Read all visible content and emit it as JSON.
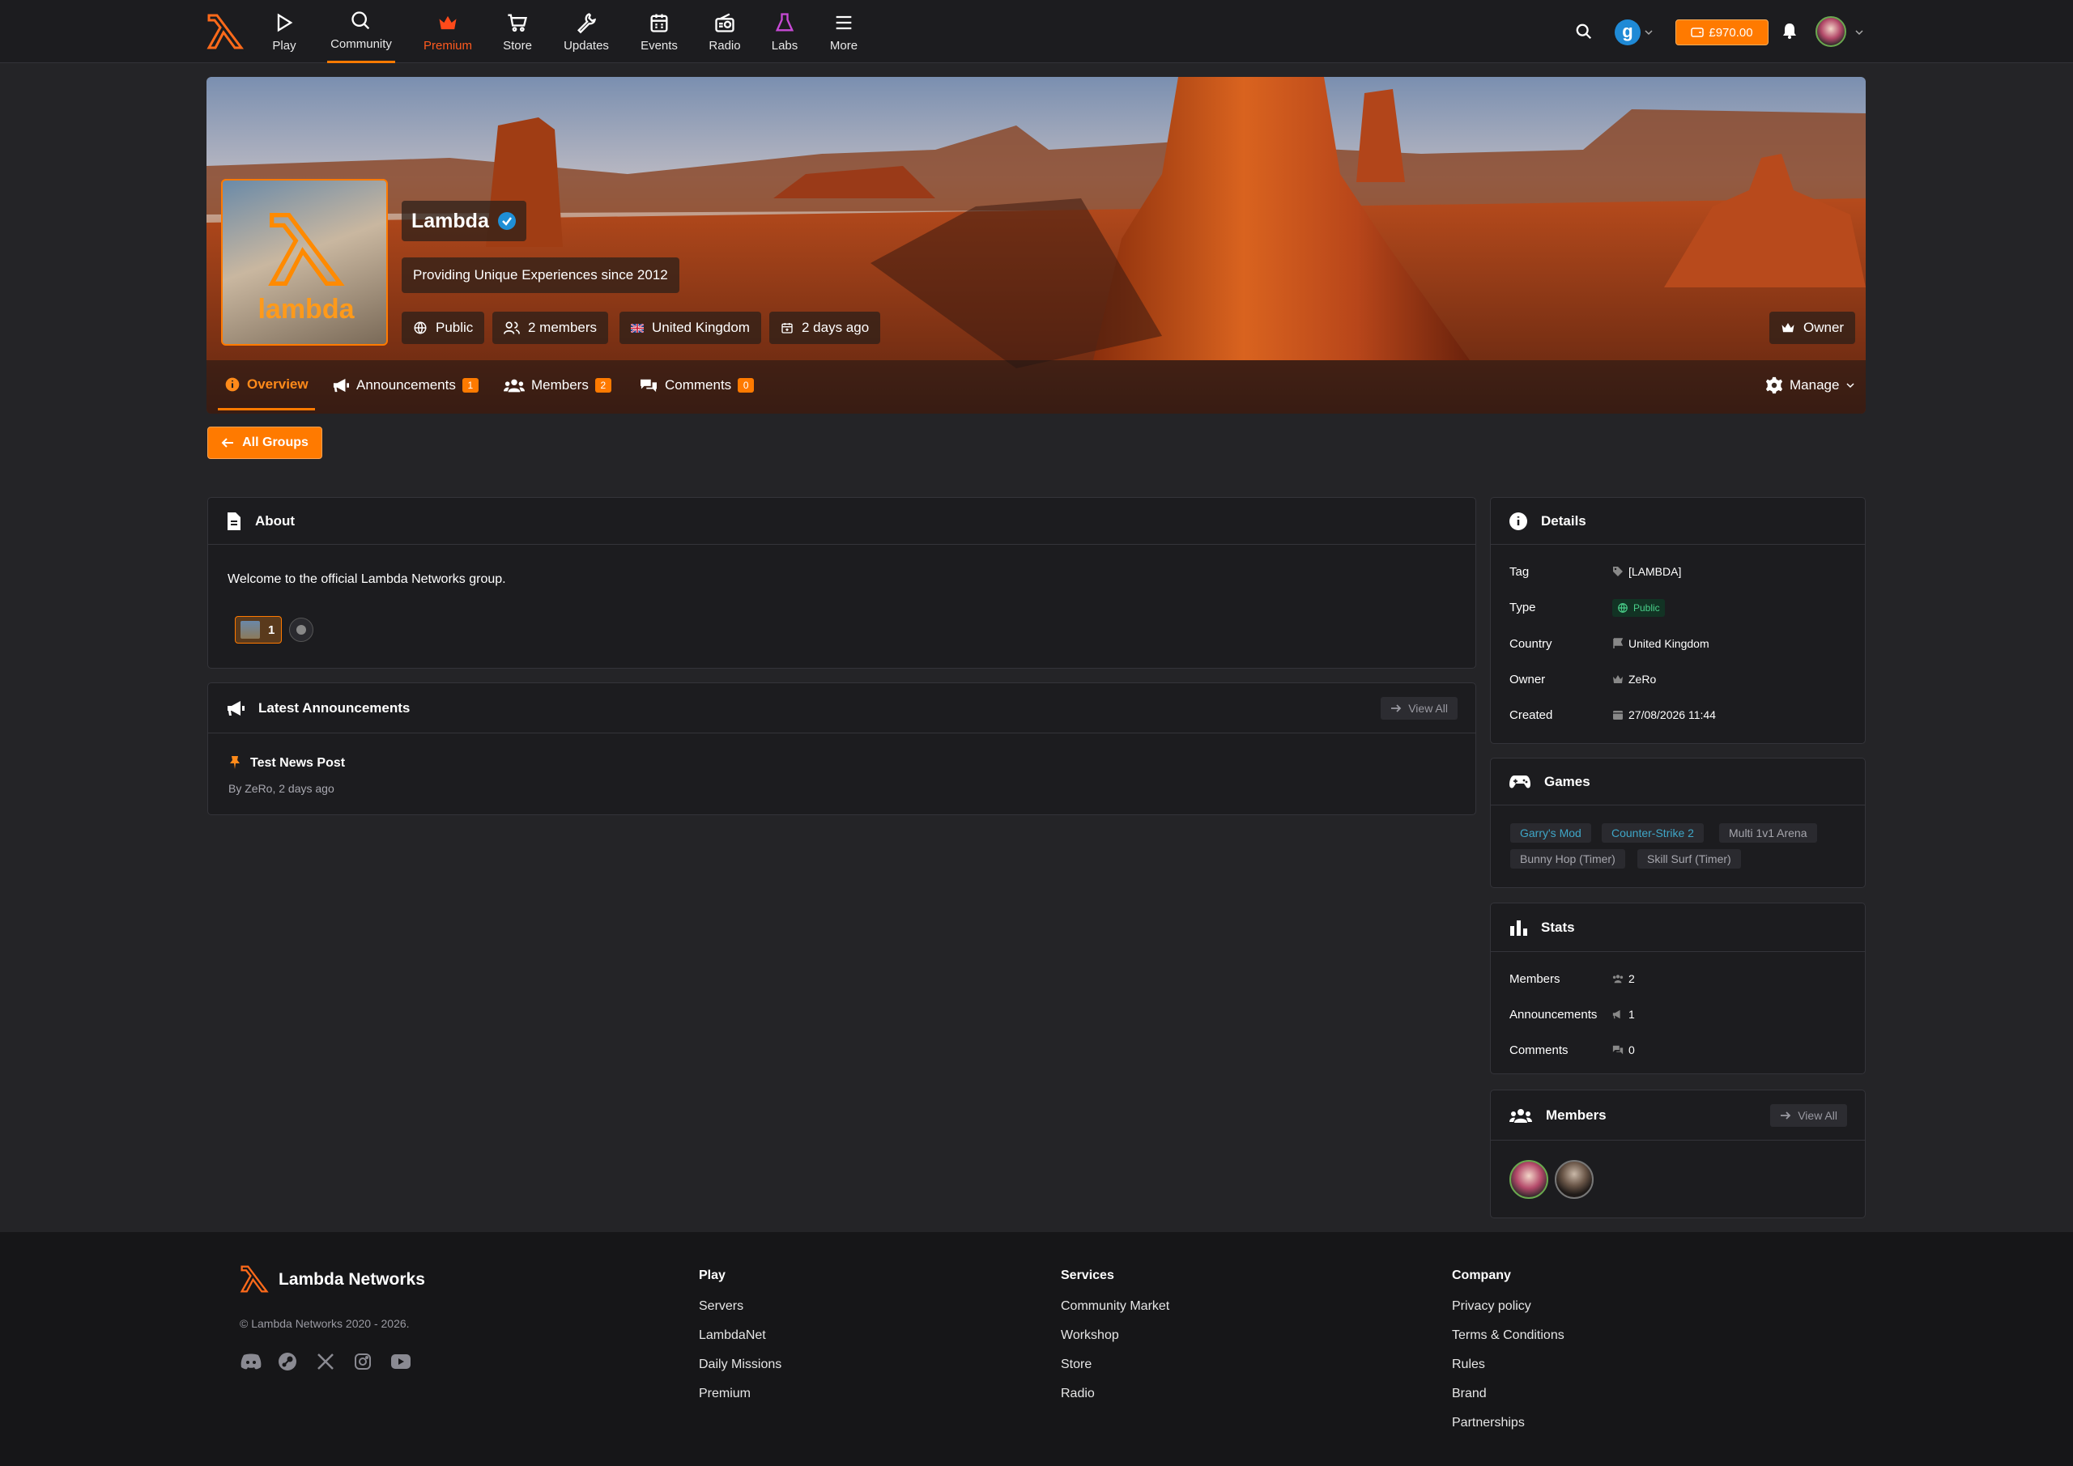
{
  "nav": {
    "items": [
      {
        "label": "Play",
        "icon": "play-icon"
      },
      {
        "label": "Community",
        "icon": "chat-icon"
      },
      {
        "label": "Premium",
        "icon": "crown-icon"
      },
      {
        "label": "Store",
        "icon": "cart-icon"
      },
      {
        "label": "Updates",
        "icon": "wrench-icon"
      },
      {
        "label": "Events",
        "icon": "calendar-icon"
      },
      {
        "label": "Radio",
        "icon": "radio-icon"
      },
      {
        "label": "Labs",
        "icon": "flask-icon"
      },
      {
        "label": "More",
        "icon": "menu-icon"
      }
    ],
    "active": "Community",
    "balance": "£970.00",
    "accent": "#ff7a00"
  },
  "group": {
    "name": "Lambda",
    "tagline": "Providing Unique Experiences since 2012",
    "avatar_text": "lambda",
    "visibility": "Public",
    "members": "2 members",
    "country": "United Kingdom",
    "created_ago": "2 days ago",
    "role": "Owner"
  },
  "tabs": [
    {
      "label": "Overview",
      "count": null
    },
    {
      "label": "Announcements",
      "count": "1"
    },
    {
      "label": "Members",
      "count": "2"
    },
    {
      "label": "Comments",
      "count": "0"
    }
  ],
  "manage_label": "Manage",
  "all_groups_label": "All Groups",
  "about": {
    "title": "About",
    "text": "Welcome to the official Lambda Networks group.",
    "reaction_count": "1"
  },
  "announcements": {
    "title": "Latest Announcements",
    "view_all": "View All",
    "post_title": "Test News Post",
    "post_meta": "By ZeRo, 2 days ago"
  },
  "details": {
    "title": "Details",
    "rows": [
      {
        "label": "Tag",
        "value": "[LAMBDA]"
      },
      {
        "label": "Type",
        "value": "Public"
      },
      {
        "label": "Country",
        "value": "United Kingdom"
      },
      {
        "label": "Owner",
        "value": "ZeRo"
      },
      {
        "label": "Created",
        "value": "27/08/2026 11:44"
      }
    ]
  },
  "games": {
    "title": "Games",
    "tags": [
      "Garry's Mod",
      "Counter-Strike 2",
      "Multi 1v1 Arena",
      "Bunny Hop (Timer)",
      "Skill Surf (Timer)"
    ]
  },
  "stats": {
    "title": "Stats",
    "rows": [
      {
        "label": "Members",
        "value": "2"
      },
      {
        "label": "Announcements",
        "value": "1"
      },
      {
        "label": "Comments",
        "value": "0"
      }
    ]
  },
  "members_card": {
    "title": "Members",
    "view_all": "View All"
  },
  "footer": {
    "brand": "Lambda Networks",
    "copyright": "© Lambda Networks 2020 - 2026.",
    "columns": [
      {
        "title": "Play",
        "links": [
          "Servers",
          "LambdaNet",
          "Daily Missions",
          "Premium"
        ]
      },
      {
        "title": "Services",
        "links": [
          "Community Market",
          "Workshop",
          "Store",
          "Radio"
        ]
      },
      {
        "title": "Company",
        "links": [
          "Privacy policy",
          "Terms & Conditions",
          "Rules",
          "Brand",
          "Partnerships"
        ]
      }
    ]
  }
}
